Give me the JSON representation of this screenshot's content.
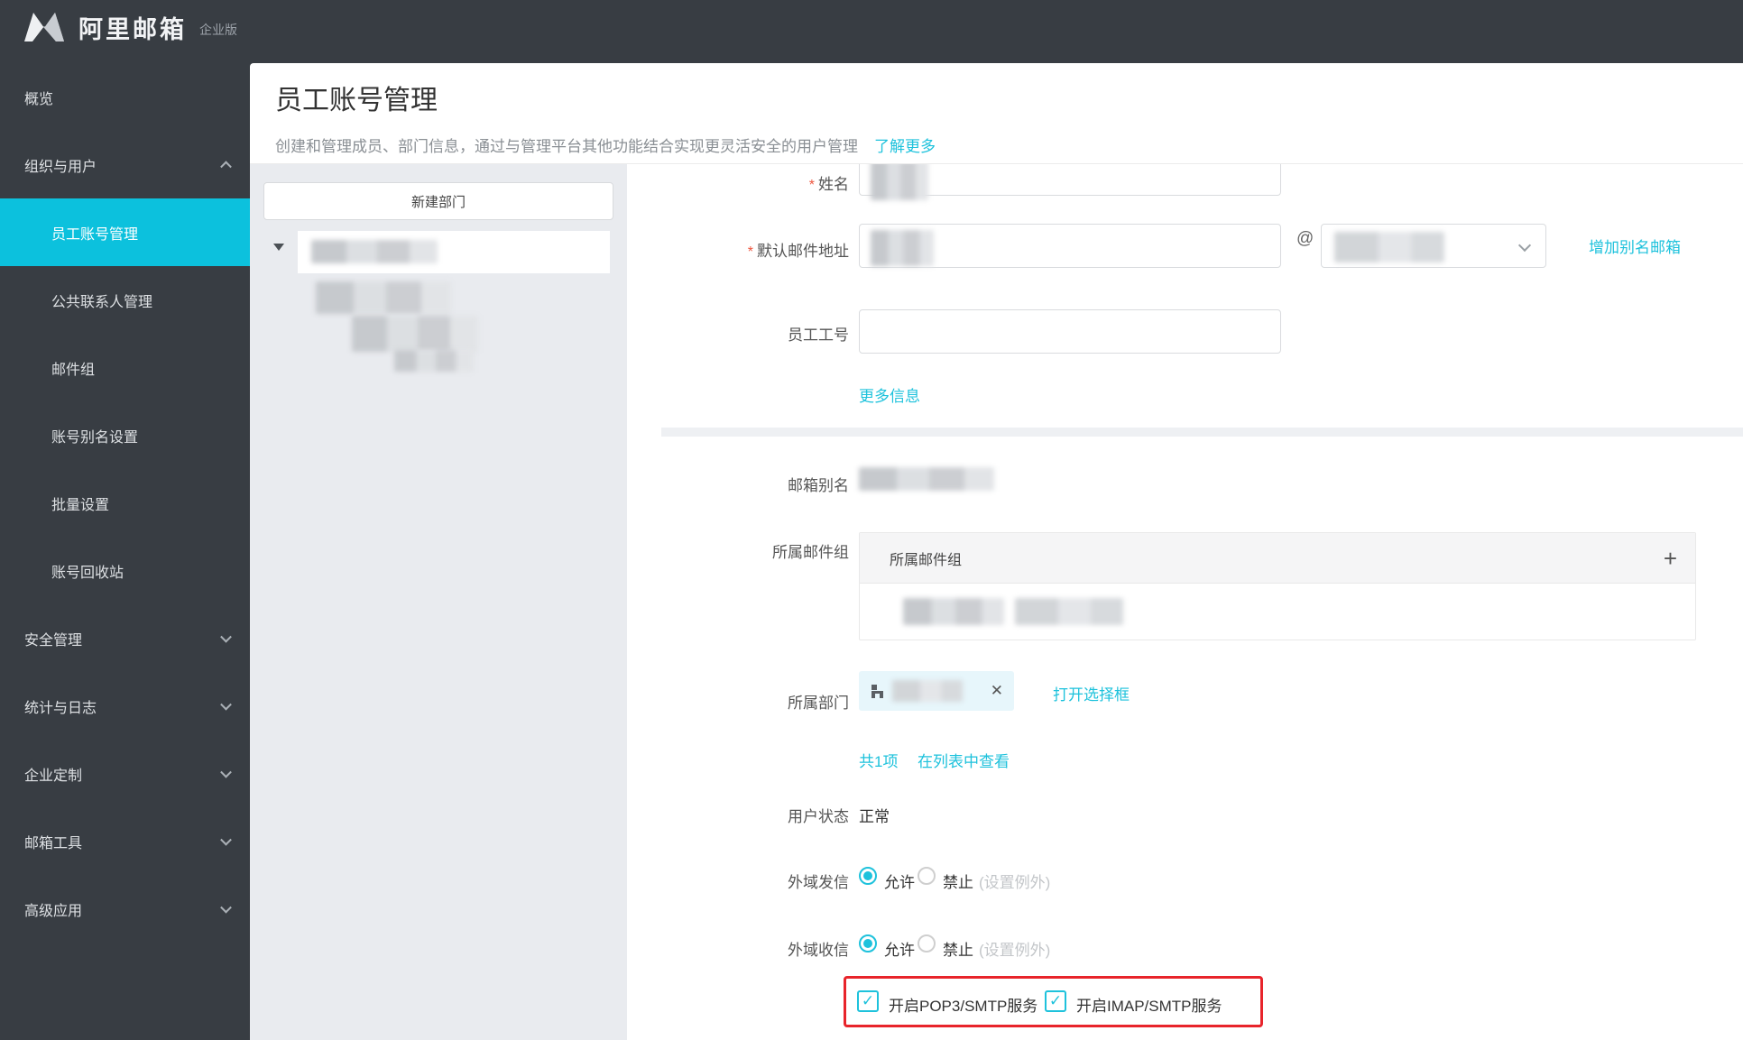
{
  "brand": {
    "logo": "M",
    "name": "阿里邮箱",
    "edition": "企业版"
  },
  "sidebar": {
    "items": [
      {
        "label": "概览",
        "level": 0,
        "active": false,
        "chevron": ""
      },
      {
        "label": "组织与用户",
        "level": 0,
        "active": false,
        "chevron": "up"
      },
      {
        "label": "员工账号管理",
        "level": 1,
        "active": true,
        "chevron": ""
      },
      {
        "label": "公共联系人管理",
        "level": 1,
        "active": false,
        "chevron": ""
      },
      {
        "label": "邮件组",
        "level": 1,
        "active": false,
        "chevron": ""
      },
      {
        "label": "账号别名设置",
        "level": 1,
        "active": false,
        "chevron": ""
      },
      {
        "label": "批量设置",
        "level": 1,
        "active": false,
        "chevron": ""
      },
      {
        "label": "账号回收站",
        "level": 1,
        "active": false,
        "chevron": ""
      },
      {
        "label": "安全管理",
        "level": 0,
        "active": false,
        "chevron": "down"
      },
      {
        "label": "统计与日志",
        "level": 0,
        "active": false,
        "chevron": "down"
      },
      {
        "label": "企业定制",
        "level": 0,
        "active": false,
        "chevron": "down"
      },
      {
        "label": "邮箱工具",
        "level": 0,
        "active": false,
        "chevron": "down"
      },
      {
        "label": "高级应用",
        "level": 0,
        "active": false,
        "chevron": "down"
      }
    ]
  },
  "page": {
    "title": "员工账号管理",
    "description": "创建和管理成员、部门信息，通过与管理平台其他功能结合实现更灵活安全的用户管理",
    "learn_more": "了解更多"
  },
  "dept_panel": {
    "new_department_button": "新建部门"
  },
  "form": {
    "required_mark": "*",
    "name_label": "姓名",
    "default_email_label": "默认邮件地址",
    "at_sign": "@",
    "add_alias_link": "增加别名邮箱",
    "employee_id_label": "员工工号",
    "employee_id_value": "",
    "more_info_link": "更多信息",
    "mailbox_alias_label": "邮箱别名",
    "mail_groups_label": "所属邮件组",
    "mail_groups_box_title": "所属邮件组",
    "add_icon": "+",
    "department_label": "所属部门",
    "remove_icon": "✕",
    "open_selector_link": "打开选择框",
    "items_count": "共1项",
    "view_in_list_link": "在列表中查看",
    "user_status_label": "用户状态",
    "user_status_value": "正常",
    "outbound_label": "外域发信",
    "inbound_label": "外域收信",
    "allow_label": "允许",
    "forbid_label": "禁止",
    "exception_label": "(设置例外)",
    "pop3_checkbox_label": "开启POP3/SMTP服务",
    "imap_checkbox_label": "开启IMAP/SMTP服务",
    "check_mark": "✓"
  },
  "colors": {
    "accent": "#1ec2dc",
    "sidebar_active": "#0cc1dd",
    "highlight_red": "#e8242b"
  }
}
